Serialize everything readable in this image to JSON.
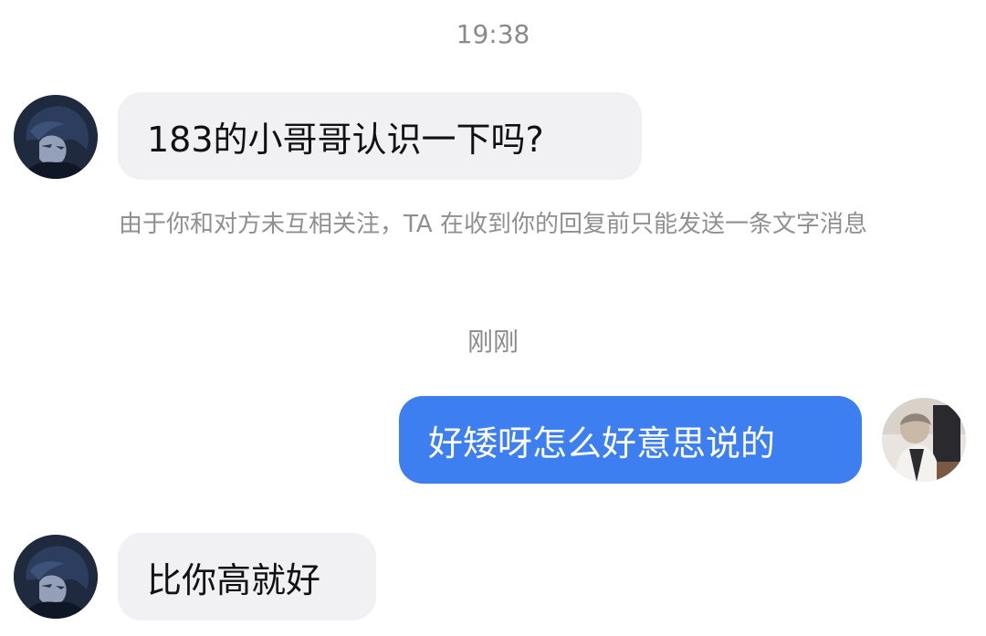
{
  "chat": {
    "timestamps": [
      "19:38",
      "刚刚"
    ],
    "notice": "由于你和对方未互相关注，TA 在收到你的回复前只能发送一条文字消息",
    "messages": [
      {
        "sender": "other",
        "text": "183的小哥哥认识一下吗?"
      },
      {
        "sender": "me",
        "text": "好矮呀怎么好意思说的"
      },
      {
        "sender": "other",
        "text": "比你高就好"
      }
    ],
    "avatars": {
      "other": "dark-anime-boy-avatar",
      "me": "user-photo-avatar"
    }
  },
  "colors": {
    "incoming_bubble": "#f1f1f3",
    "outgoing_bubble": "#3d7ff0",
    "meta_text": "#8a8a8a"
  }
}
